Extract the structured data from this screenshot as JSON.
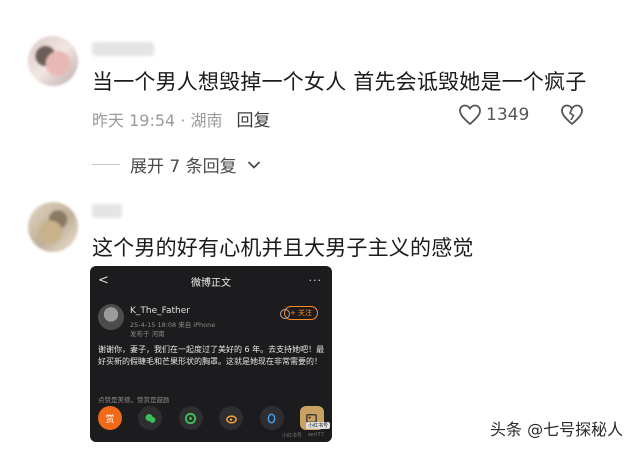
{
  "comments": [
    {
      "text": "当一个男人想毁掉一个女人 首先会诋毁她是一个疯子",
      "meta_time": "昨天 19:54 · 湖南",
      "reply_label": "回复",
      "like_count": "1349",
      "expand_label": "展开 7 条回复"
    },
    {
      "text": "这个男的好有心机并且大男子主义的感觉"
    }
  ],
  "embedded_screenshot": {
    "title": "微博正文",
    "back_icon": "<",
    "more_icon": "···",
    "poster_name": "K_The_Father",
    "poster_meta": "25-4-15 18:08  来自 iPhone",
    "poster_meta2": "发布于 河南",
    "follow_label": "+ 关注",
    "body_text": "谢谢你，妻子，我们在一起度过了美好的 6 年。去支持她吧！最好买新的假睫毛和芒果形状的胸罩。这就是她现在非常需要的！",
    "tip_text": "点赞是美德，赞赏是鼓励",
    "reward_label": "赏",
    "hot_badge": "小红书号",
    "last_label": "小红书号",
    "last_label2": "sert77"
  },
  "watermark": "头条 @七号探秘人"
}
